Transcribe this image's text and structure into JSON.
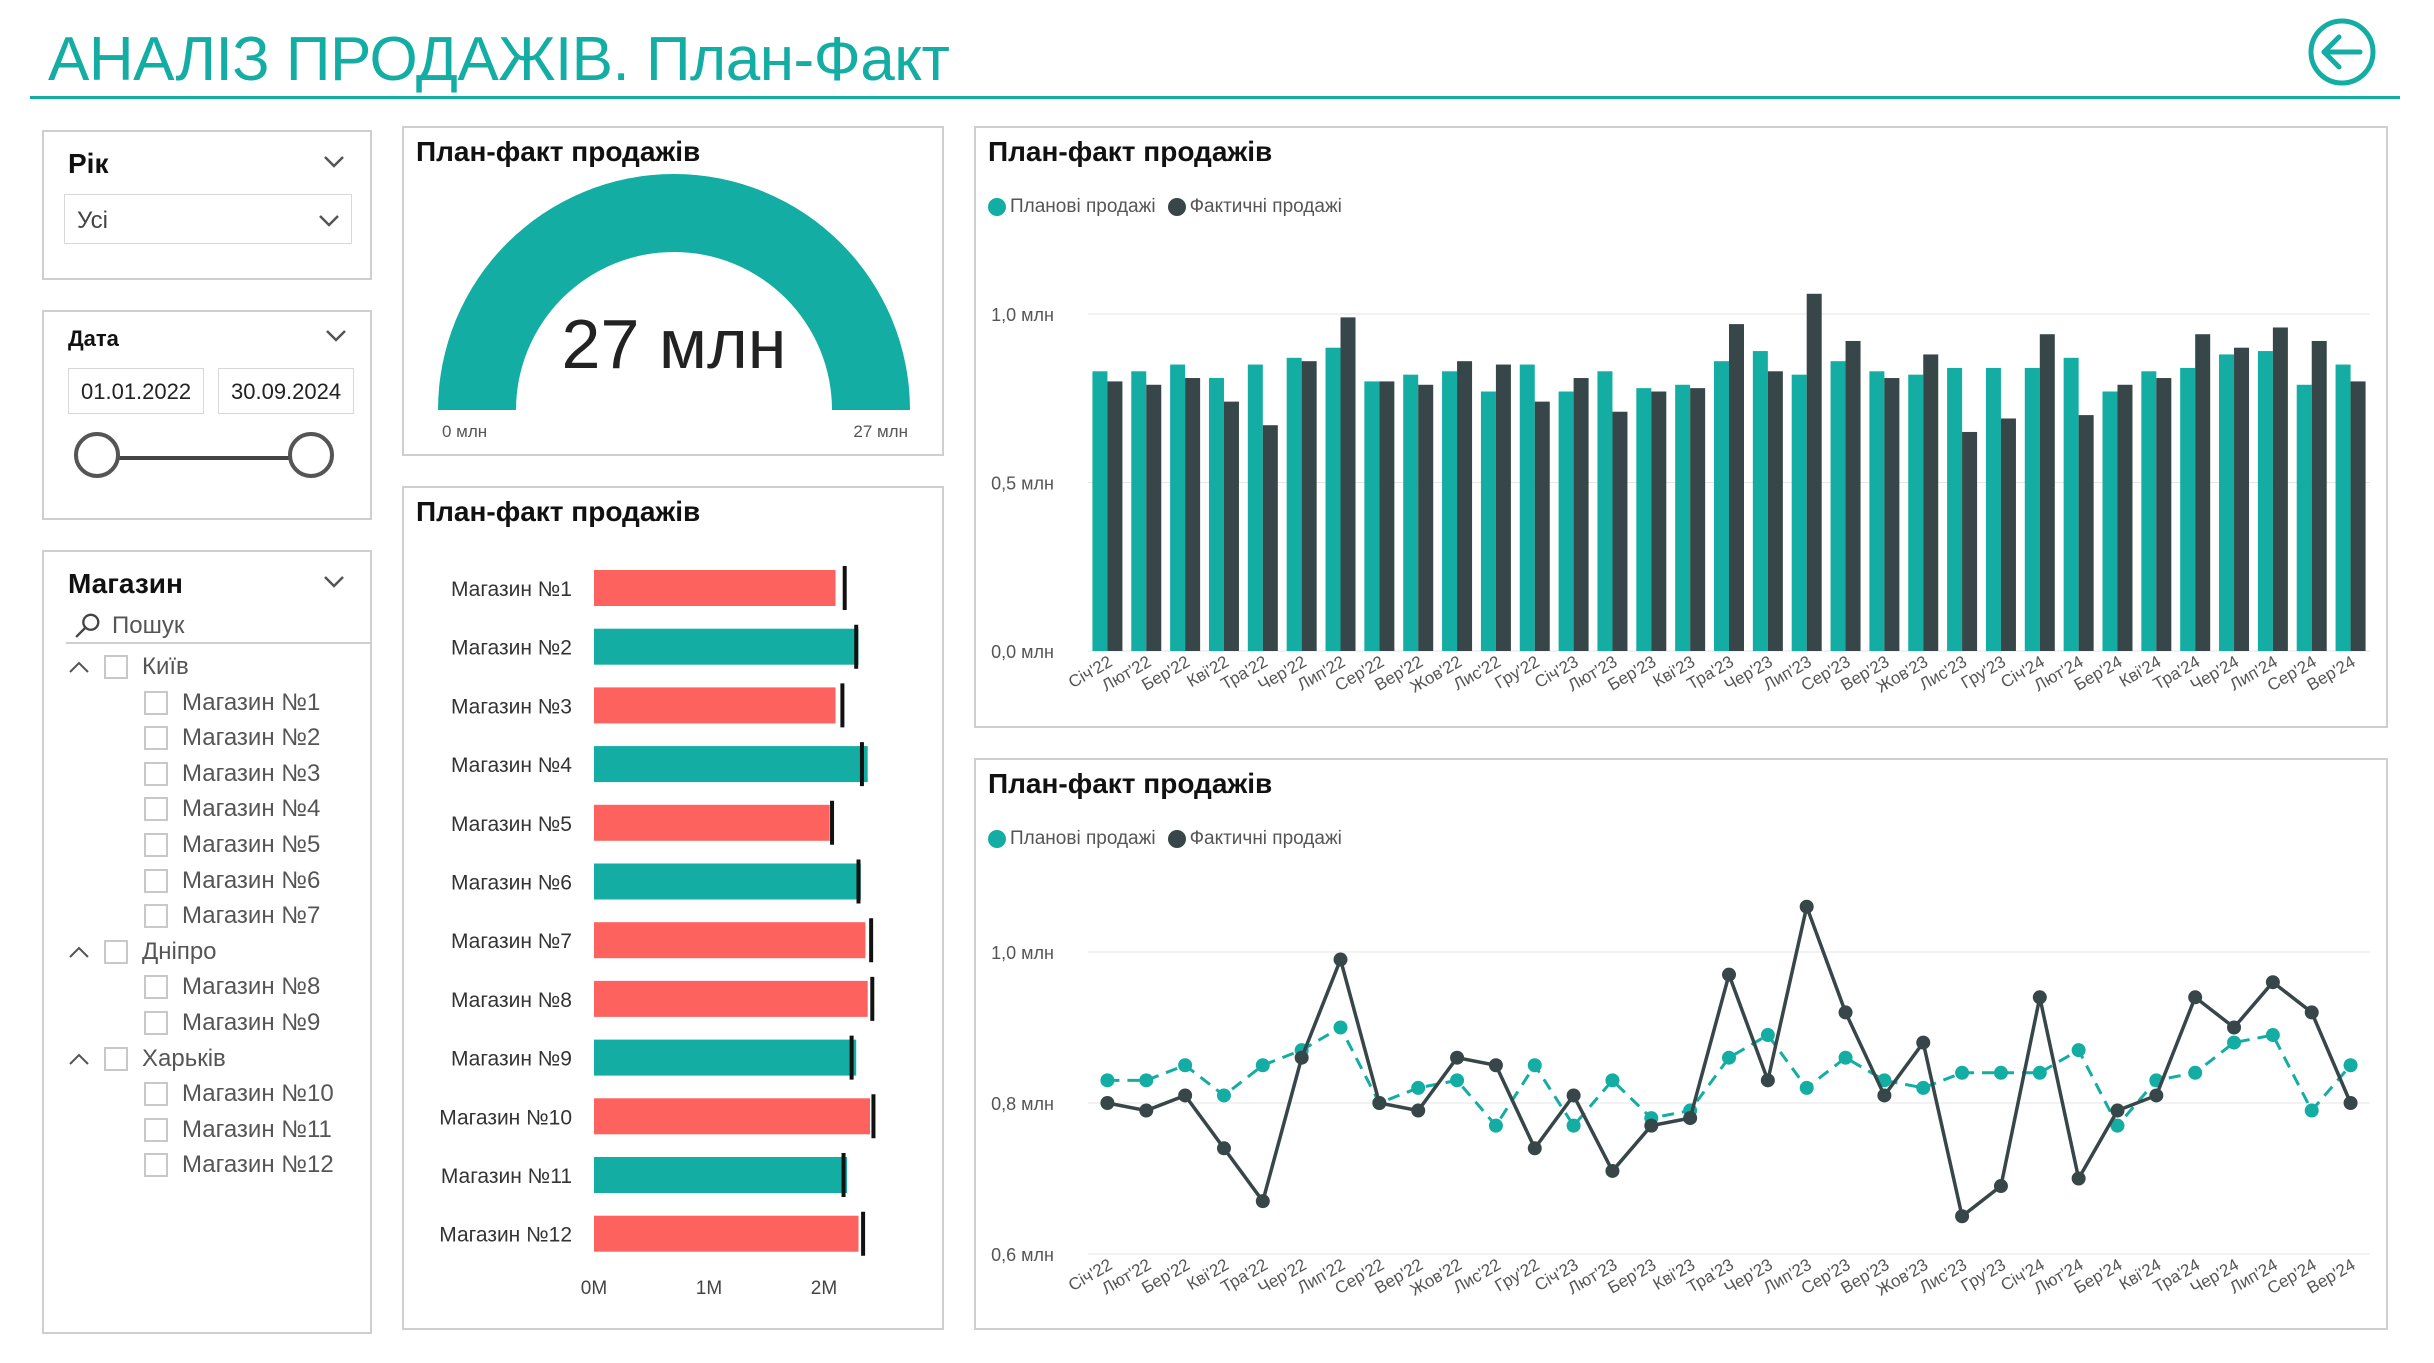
{
  "header": {
    "title_main": "АНАЛІЗ ПРОДАЖІВ",
    "title_dot": ".",
    "title_sub": " План-Факт"
  },
  "colors": {
    "accent": "#13ada3",
    "plan": "#13ada3",
    "fact": "#374649",
    "below_target": "#fd625e",
    "panel_border": "#cfcfcf"
  },
  "icons": {
    "back": "arrow-left-circle-icon",
    "search": "magnifier-icon",
    "dropdown": "chevron-down-icon"
  },
  "year_slicer": {
    "title": "Рік",
    "selected": "Усі"
  },
  "date_slicer": {
    "title": "Дата",
    "start": "01.01.2022",
    "end": "30.09.2024"
  },
  "store_slicer": {
    "title": "Магазин",
    "search_placeholder": "Пошук",
    "groups": [
      {
        "city": "Київ",
        "stores": [
          "Магазин №1",
          "Магазин №2",
          "Магазин №3",
          "Магазин №4",
          "Магазин №5",
          "Магазин №6",
          "Магазин №7"
        ]
      },
      {
        "city": "Дніпро",
        "stores": [
          "Магазин №8",
          "Магазин №9"
        ]
      },
      {
        "city": "Харьків",
        "stores": [
          "Магазин №10",
          "Магазин №11",
          "Магазин №12"
        ]
      }
    ]
  },
  "gauge": {
    "title": "План-факт продажів",
    "value_label": "27 млн",
    "min_label": "0 млн",
    "max_label": "27 млн"
  },
  "stores_chart": {
    "title": "План-факт продажів"
  },
  "bar_chart": {
    "title": "План-факт продажів",
    "legend_plan": "Планові продажі",
    "legend_fact": "Фактичні продажі"
  },
  "line_chart": {
    "title": "План-факт продажів",
    "legend_plan": "Планові продажі",
    "legend_fact": "Фактичні продажі"
  },
  "chart_data": [
    {
      "type": "gauge",
      "title": "План-факт продажів",
      "value": 27,
      "min": 0,
      "max": 27,
      "unit": "млн"
    },
    {
      "type": "bar",
      "orientation": "horizontal",
      "title": "План-факт продажів",
      "categories": [
        "Магазин №1",
        "Магазин №2",
        "Магазин №3",
        "Магазин №4",
        "Магазин №5",
        "Магазин №6",
        "Магазин №7",
        "Магазин №8",
        "Магазин №9",
        "Магазин №10",
        "Магазин №11",
        "Магазин №12"
      ],
      "series": [
        {
          "values": [
            2.1,
            2.3,
            2.1,
            2.38,
            2.05,
            2.32,
            2.36,
            2.38,
            2.28,
            2.4,
            2.2,
            2.3
          ]
        },
        {
          "values": [
            2.18,
            2.28,
            2.16,
            2.33,
            2.07,
            2.3,
            2.41,
            2.42,
            2.24,
            2.43,
            2.17,
            2.34
          ]
        }
      ],
      "xticks": [
        "0M",
        "1M",
        "2M"
      ],
      "xlim": [
        0,
        2.5
      ]
    },
    {
      "type": "bar",
      "title": "План-факт продажів",
      "ylabel": "",
      "yticks": [
        "0,0 млн",
        "0,5 млн",
        "1,0 млн"
      ],
      "ylim": [
        0,
        1.1
      ],
      "legend": "top-left",
      "grid": true,
      "categories": [
        "Січ'22",
        "Лют'22",
        "Бер'22",
        "Кві'22",
        "Тра'22",
        "Чер'22",
        "Лип'22",
        "Сер'22",
        "Вер'22",
        "Жов'22",
        "Лис'22",
        "Гру'22",
        "Січ'23",
        "Лют'23",
        "Бер'23",
        "Кві'23",
        "Тра'23",
        "Чер'23",
        "Лип'23",
        "Сер'23",
        "Вер'23",
        "Жов'23",
        "Лис'23",
        "Гру'23",
        "Січ'24",
        "Лют'24",
        "Бер'24",
        "Кві'24",
        "Тра'24",
        "Чер'24",
        "Лип'24",
        "Сер'24",
        "Вер'24"
      ],
      "series": [
        {
          "name": "Планові продажі",
          "values": [
            0.83,
            0.83,
            0.85,
            0.81,
            0.85,
            0.87,
            0.9,
            0.8,
            0.82,
            0.83,
            0.77,
            0.85,
            0.77,
            0.83,
            0.78,
            0.79,
            0.86,
            0.89,
            0.82,
            0.86,
            0.83,
            0.82,
            0.84,
            0.84,
            0.84,
            0.87,
            0.77,
            0.83,
            0.84,
            0.88,
            0.89,
            0.79,
            0.85
          ]
        },
        {
          "name": "Фактичні продажі",
          "values": [
            0.8,
            0.79,
            0.81,
            0.74,
            0.67,
            0.86,
            0.99,
            0.8,
            0.79,
            0.86,
            0.85,
            0.74,
            0.81,
            0.71,
            0.77,
            0.78,
            0.97,
            0.83,
            1.06,
            0.92,
            0.81,
            0.88,
            0.65,
            0.69,
            0.94,
            0.7,
            0.79,
            0.81,
            0.94,
            0.9,
            0.96,
            0.92,
            0.8
          ]
        }
      ]
    },
    {
      "type": "line",
      "title": "План-факт продажів",
      "yticks": [
        "0,6 млн",
        "0,8 млн",
        "1,0 млн"
      ],
      "ylim": [
        0.6,
        1.08
      ],
      "legend": "top-left",
      "grid": true,
      "categories": [
        "Січ'22",
        "Лют'22",
        "Бер'22",
        "Кві'22",
        "Тра'22",
        "Чер'22",
        "Лип'22",
        "Сер'22",
        "Вер'22",
        "Жов'22",
        "Лис'22",
        "Гру'22",
        "Січ'23",
        "Лют'23",
        "Бер'23",
        "Кві'23",
        "Тра'23",
        "Чер'23",
        "Лип'23",
        "Сер'23",
        "Вер'23",
        "Жов'23",
        "Лис'23",
        "Гру'23",
        "Січ'24",
        "Лют'24",
        "Бер'24",
        "Кві'24",
        "Тра'24",
        "Чер'24",
        "Лип'24",
        "Сер'24",
        "Вер'24"
      ],
      "series": [
        {
          "name": "Планові продажі",
          "values": [
            0.83,
            0.83,
            0.85,
            0.81,
            0.85,
            0.87,
            0.9,
            0.8,
            0.82,
            0.83,
            0.77,
            0.85,
            0.77,
            0.83,
            0.78,
            0.79,
            0.86,
            0.89,
            0.82,
            0.86,
            0.83,
            0.82,
            0.84,
            0.84,
            0.84,
            0.87,
            0.77,
            0.83,
            0.84,
            0.88,
            0.89,
            0.79,
            0.85
          ]
        },
        {
          "name": "Фактичні продажі",
          "values": [
            0.8,
            0.79,
            0.81,
            0.74,
            0.67,
            0.86,
            0.99,
            0.8,
            0.79,
            0.86,
            0.85,
            0.74,
            0.81,
            0.71,
            0.77,
            0.78,
            0.97,
            0.83,
            1.06,
            0.92,
            0.81,
            0.88,
            0.65,
            0.69,
            0.94,
            0.7,
            0.79,
            0.81,
            0.94,
            0.9,
            0.96,
            0.92,
            0.8
          ]
        }
      ]
    }
  ]
}
